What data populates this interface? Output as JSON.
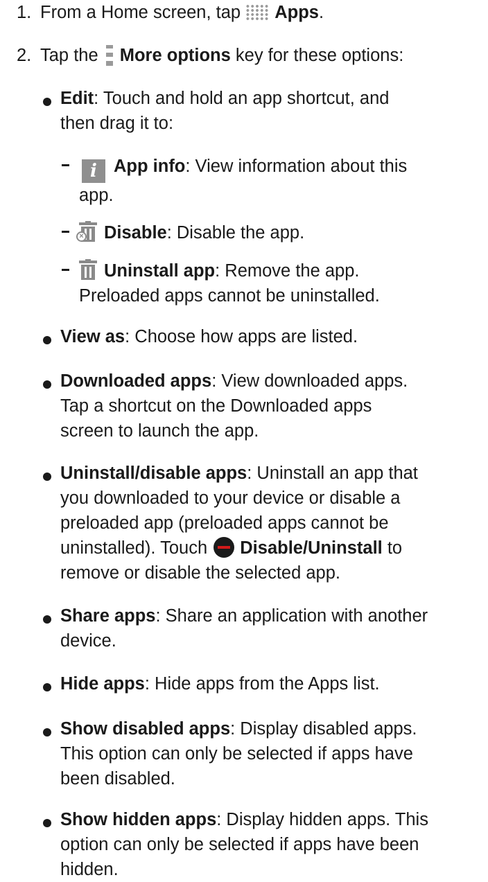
{
  "steps": [
    {
      "num": "1.",
      "lines": [
        {
          "pre": "From a Home screen, tap ",
          "icon": "apps-grid-icon",
          "bold": "Apps",
          "post": "."
        }
      ]
    },
    {
      "num": "2.",
      "lines": [
        {
          "pre": "Tap the ",
          "icon": "more-options-icon",
          "bold": "More options",
          "post": " key for these options:"
        }
      ]
    }
  ],
  "edit": {
    "term": "Edit",
    "desc_line1": ": Touch and hold an app shortcut, and",
    "desc_line2": "then drag it to:",
    "targets": [
      {
        "icon": "app-info-icon",
        "term": "App info",
        "desc_line1": ": View information about this",
        "desc_line2": "app."
      },
      {
        "icon": "disable-icon",
        "term": "Disable",
        "desc_line1": ": Disable the app.",
        "desc_line2": ""
      },
      {
        "icon": "uninstall-icon",
        "term": "Uninstall app",
        "desc_line1": ": Remove the app.",
        "desc_line2": "Preloaded apps cannot be uninstalled."
      }
    ]
  },
  "options": [
    {
      "term": "View as",
      "line1": ": Choose how apps are listed."
    },
    {
      "term": "Downloaded apps",
      "line1": ": View downloaded apps.",
      "line2": "Tap a shortcut on the Downloaded apps",
      "line3": "screen to launch the app."
    },
    {
      "term": "Uninstall/disable apps",
      "line1": ": Uninstall an app that",
      "line2": "you downloaded to your device or disable a",
      "line3": "preloaded app (preloaded apps cannot be",
      "line4_pre": "uninstalled). Touch ",
      "line4_bold": "Disable/Uninstall",
      "line4_post": " to",
      "line5": "remove or disable the selected app."
    },
    {
      "term": "Share apps",
      "line1": ": Share an application with another",
      "line2": "device."
    },
    {
      "term": "Hide apps",
      "line1": ": Hide apps from the Apps list."
    },
    {
      "term": "Show disabled apps",
      "line1": ": Display disabled apps.",
      "line2": "This option can only be selected if apps have",
      "line3": "been disabled."
    },
    {
      "term": "Show hidden apps",
      "line1": ": Display hidden apps. This",
      "line2": "option can only be selected if apps have been",
      "line3": "hidden."
    }
  ],
  "info_icon_glyph": "i",
  "disable_icon_glyph": "×"
}
